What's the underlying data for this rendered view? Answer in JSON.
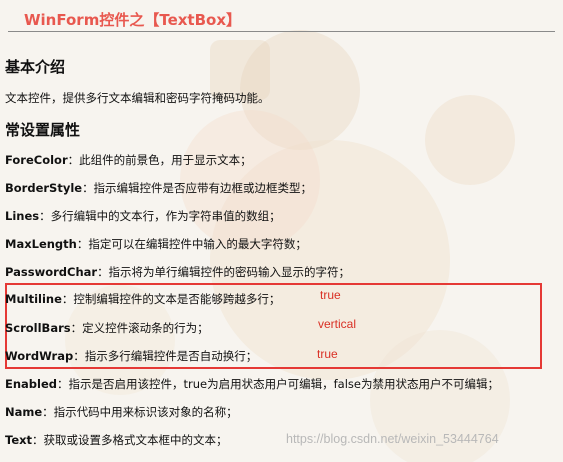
{
  "title": "WinForm控件之【TextBox】",
  "section_intro": {
    "heading": "基本介绍",
    "text": "文本控件，提供多行文本编辑和密码字符掩码功能。"
  },
  "section_props": {
    "heading": "常设置属性",
    "items": [
      {
        "name": "ForeColor",
        "desc": "：此组件的前景色，用于显示文本；"
      },
      {
        "name": "BorderStyle",
        "desc": "：指示编辑控件是否应带有边框或边框类型；"
      },
      {
        "name": "Lines",
        "desc": "：多行编辑中的文本行，作为字符串值的数组；"
      },
      {
        "name": "MaxLength",
        "desc": "：指定可以在编辑控件中输入的最大字符数；"
      },
      {
        "name": "PasswordChar",
        "desc": "：指示将为单行编辑控件的密码输入显示的字符；"
      },
      {
        "name": "Multiline",
        "desc": "：控制编辑控件的文本是否能够跨越多行；"
      },
      {
        "name": "ScrollBars",
        "desc": "：定义控件滚动条的行为；"
      },
      {
        "name": "WordWrap",
        "desc": "：指示多行编辑控件是否自动换行；"
      },
      {
        "name": "Enabled",
        "desc": "：指示是否启用该控件，true为启用状态用户可编辑，false为禁用状态用户不可编辑；"
      },
      {
        "name": "Name",
        "desc": "：指示代码中用来标识该对象的名称；"
      },
      {
        "name": "Text",
        "desc": "：获取或设置多格式文本框中的文本；"
      }
    ]
  },
  "annotations": {
    "multiline": "true",
    "scrollbars": "vertical",
    "wordwrap": "true"
  },
  "watermark": "https://blog.csdn.net/weixin_53444764",
  "colors": {
    "title": "#e8584f",
    "highlight": "#e53935",
    "annotation": "#d93025"
  }
}
